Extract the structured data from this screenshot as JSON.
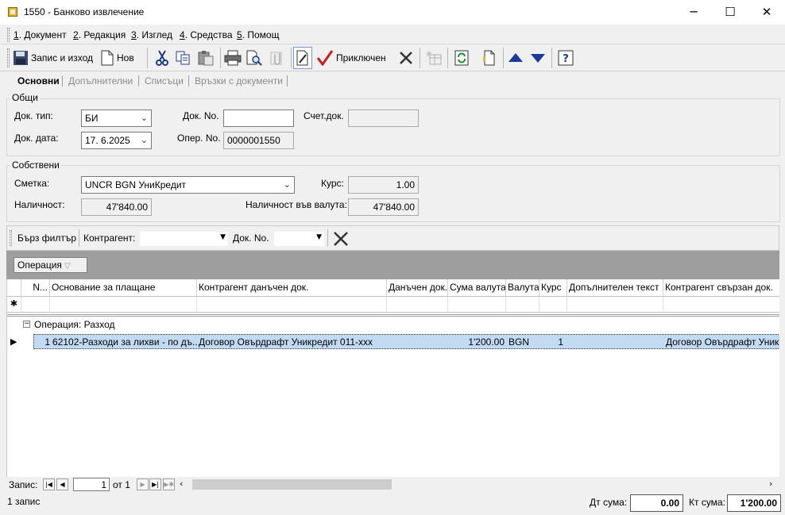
{
  "window": {
    "title": "1550 - Банково извлечение",
    "minimize": "─",
    "maximize": "☐",
    "close": "✕"
  },
  "menu": [
    {
      "num": "1",
      "text": ". Документ"
    },
    {
      "num": "2",
      "text": ". Редакция"
    },
    {
      "num": "3",
      "text": ". Изглед"
    },
    {
      "num": "4",
      "text": ". Средства"
    },
    {
      "num": "5",
      "text": ". Помощ"
    }
  ],
  "toolbar": {
    "save_exit": "Запис и изход",
    "new": "Нов",
    "finished": "Приключен"
  },
  "tabs": [
    "Основни",
    "Допълнителни",
    "Списъци",
    "Връзки с документи"
  ],
  "general": {
    "title": "Общи",
    "doc_type_label": "Док. тип:",
    "doc_type_value": "БИ",
    "doc_no_label": "Док. No.",
    "doc_no_value": "",
    "acc_doc_label": "Счет.док.",
    "acc_doc_value": "",
    "doc_date_label": "Док. дата:",
    "doc_date_value": "17.  6.2025",
    "oper_no_label": "Опер. No.",
    "oper_no_value": "0000001550"
  },
  "own": {
    "title": "Собствени",
    "account_label": "Сметка:",
    "account_value": "UNCR BGN УниКредит",
    "rate_label": "Курс:",
    "rate_value": "1.00",
    "availability_label": "Наличност:",
    "availability_value": "47'840.00",
    "availability_cur_label": "Наличност във валута:",
    "availability_cur_value": "47'840.00"
  },
  "filter": {
    "quick": "Бърз филтър",
    "contractor_label": "Контрагент:",
    "contractor_value": "",
    "docno_label": "Док. No.",
    "docno_value": ""
  },
  "grouping": {
    "chip": "Операция",
    "chip_arrow": "▽"
  },
  "grid": {
    "columns": [
      "N...",
      "Основание за плащане",
      "Контрагент данъчен док.",
      "Данъчен док...",
      "Сума валута",
      "Валута",
      "Курс",
      "Допълнителен текст",
      "Контрагент свързан док."
    ],
    "new_row_marker": "✱",
    "group_toggle": "−",
    "group_label": "Операция: Разход",
    "row_indicator": "▶",
    "rows": [
      {
        "n": "1",
        "basis": "62102-Разходи за лихви - по дъ...",
        "contractor_tax": "Договор Овърдрафт Уникредит 011-xxx",
        "tax_doc": "",
        "amount": "1'200.00",
        "currency": "BGN",
        "rate": "1",
        "extra": "",
        "contractor_linked": "Договор Овърдрафт Уникр"
      }
    ]
  },
  "navigator": {
    "label": "Запис:",
    "current": "1",
    "of": "от 1"
  },
  "status": {
    "count": "1 запис",
    "debit_label": "Дт сума:",
    "debit_value": "0.00",
    "credit_label": "Кт сума:",
    "credit_value": "1'200.00"
  }
}
